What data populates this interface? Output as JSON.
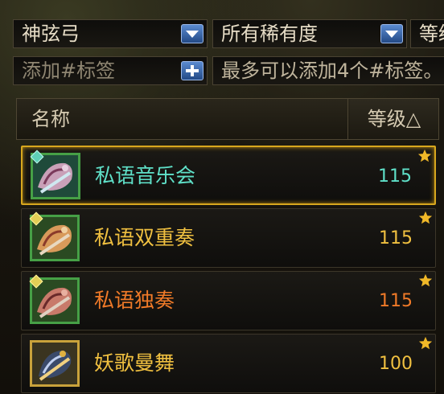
{
  "filters": {
    "weapon_type": "神弦弓",
    "rarity": "所有稀有度",
    "level_partial": "等级"
  },
  "tag": {
    "placeholder": "添加#标签",
    "hint": "最多可以添加4个#标签。"
  },
  "table": {
    "col_name": "名称",
    "col_level": "等级△"
  },
  "items": [
    {
      "name": "私语音乐会",
      "level": "115",
      "name_color": "#5fe0c8",
      "level_color": "#5fe0c8",
      "selected": true
    },
    {
      "name": "私语双重奏",
      "level": "115",
      "name_color": "#f0c040",
      "level_color": "#f0c040",
      "selected": false
    },
    {
      "name": "私语独奏",
      "level": "115",
      "name_color": "#f07a28",
      "level_color": "#f07a28",
      "selected": false
    },
    {
      "name": "妖歌曼舞",
      "level": "100",
      "name_color": "#f0c040",
      "level_color": "#f0c040",
      "selected": false
    }
  ],
  "colors": {
    "selected_border": "#d8a71e",
    "star": "#f0b828"
  },
  "icons": [
    "chevron-down-icon",
    "plus-icon",
    "star-icon",
    "gem-icon"
  ]
}
